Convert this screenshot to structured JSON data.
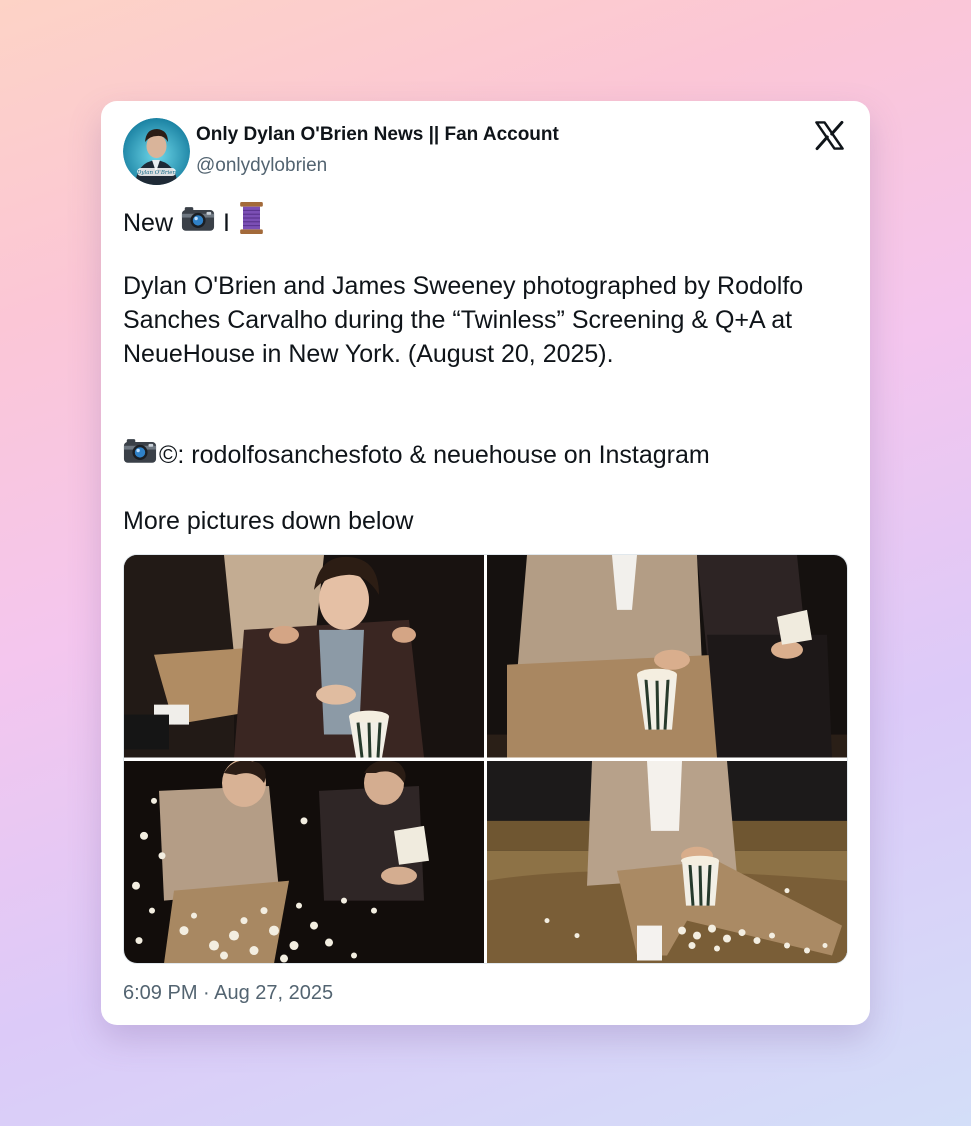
{
  "tweet": {
    "author_name": "Only Dylan O'Brien News || Fan Account",
    "author_handle": "@onlydylobrien",
    "line1_word": "New",
    "line1_separator": "I",
    "line1_icons": [
      "camera-icon",
      "thread-spool-icon"
    ],
    "paragraph": "Dylan O'Brien and James Sweeney photographed by Rodolfo Sanches Carvalho during the “Twinless” Screening & Q+A at NeueHouse in New York. (August 20, 2025).",
    "credit_text": "©: rodolfosanchesfoto & neuehouse on Instagram",
    "more_text": "More pictures down below",
    "timestamp": "6:09 PM · Aug 27, 2025",
    "avatar_caption": "Dylan O'Brien",
    "photos": [
      "photo-1",
      "photo-2",
      "photo-3",
      "photo-4"
    ]
  },
  "brand": {
    "logo": "x-logo-icon",
    "text_color": "#0f1419",
    "secondary_color": "#536471"
  }
}
